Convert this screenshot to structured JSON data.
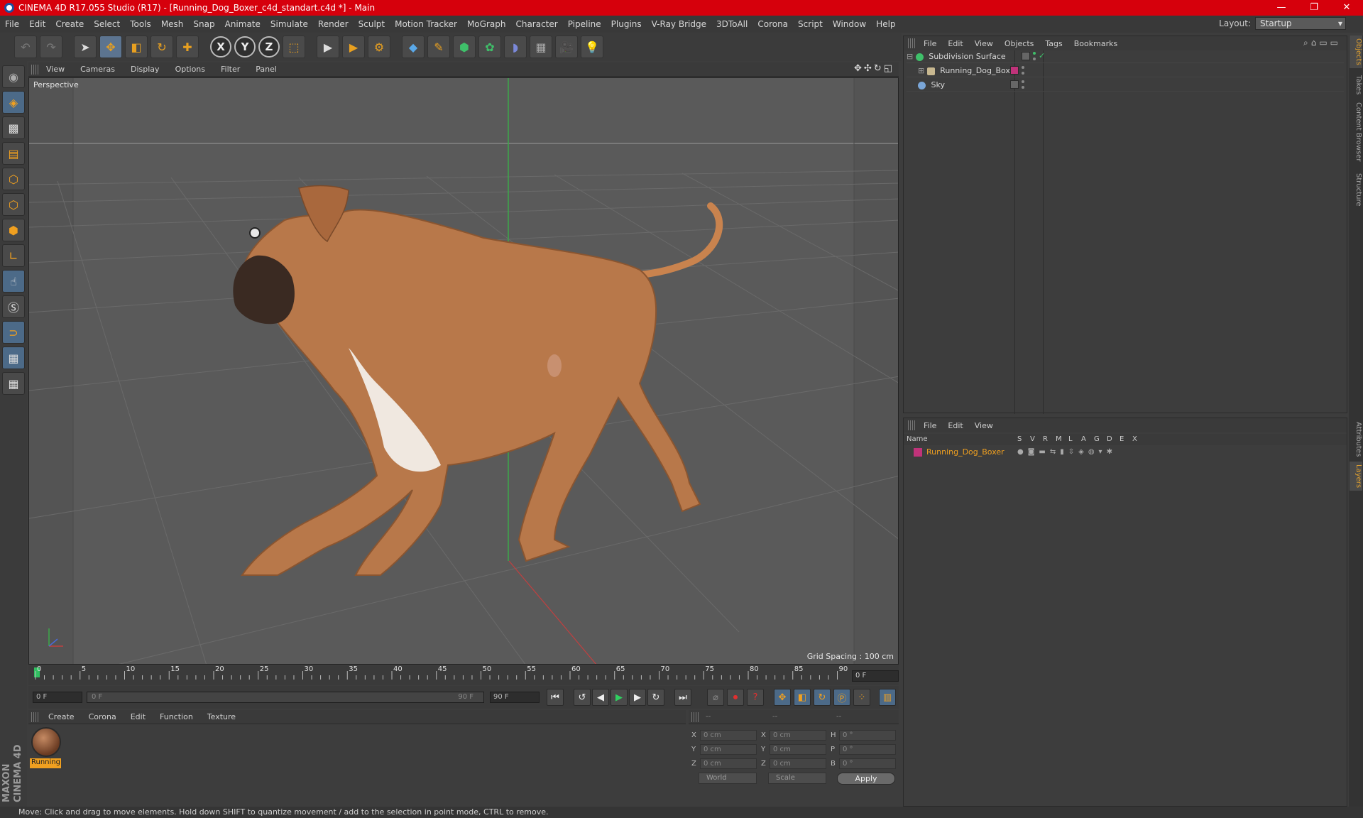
{
  "window": {
    "title": "CINEMA 4D R17.055 Studio (R17) - [Running_Dog_Boxer_c4d_standart.c4d *] - Main",
    "controls": [
      "—",
      "❐",
      "✕"
    ]
  },
  "menubar": {
    "items": [
      "File",
      "Edit",
      "Create",
      "Select",
      "Tools",
      "Mesh",
      "Snap",
      "Animate",
      "Simulate",
      "Render",
      "Sculpt",
      "Motion Tracker",
      "MoGraph",
      "Character",
      "Pipeline",
      "Plugins",
      "V-Ray Bridge",
      "3DToAll",
      "Corona",
      "Script",
      "Window",
      "Help"
    ],
    "layout_label": "Layout:",
    "layout_value": "Startup"
  },
  "viewport": {
    "menu": [
      "View",
      "Cameras",
      "Display",
      "Options",
      "Filter",
      "Panel"
    ],
    "label": "Perspective",
    "grid_spacing": "Grid Spacing : 100 cm",
    "nav_icons": "✥✣↻◱"
  },
  "timeline": {
    "ticks": [
      "0",
      "5",
      "10",
      "15",
      "20",
      "25",
      "30",
      "35",
      "40",
      "45",
      "50",
      "55",
      "60",
      "65",
      "70",
      "75",
      "80",
      "85",
      "90"
    ],
    "current_frame": "0 F",
    "start_frame": "0 F",
    "range_start": "0 F",
    "range_end": "90 F",
    "end_frame": "90 F"
  },
  "material_manager": {
    "menu": [
      "Create",
      "Corona",
      "Edit",
      "Function",
      "Texture"
    ],
    "material_name": "Running"
  },
  "coordinates": {
    "header": [
      "--",
      "--",
      "--"
    ],
    "rows": [
      {
        "a": "X",
        "av": "0 cm",
        "b": "X",
        "bv": "0 cm",
        "c": "H",
        "cv": "0 °"
      },
      {
        "a": "Y",
        "av": "0 cm",
        "b": "Y",
        "bv": "0 cm",
        "c": "P",
        "cv": "0 °"
      },
      {
        "a": "Z",
        "av": "0 cm",
        "b": "Z",
        "bv": "0 cm",
        "c": "B",
        "cv": "0 °"
      }
    ],
    "mode1": "World",
    "mode2": "Scale",
    "apply": "Apply"
  },
  "object_manager": {
    "menu": [
      "File",
      "Edit",
      "View",
      "Objects",
      "Tags",
      "Bookmarks"
    ],
    "objects": [
      {
        "name": "Subdivision Surface",
        "color": "#3fc06a"
      },
      {
        "name": "Running_Dog_Boxer",
        "color": "#c8b890"
      },
      {
        "name": "Sky",
        "color": "#7aa6d8"
      }
    ]
  },
  "layer_manager": {
    "menu": [
      "File",
      "Edit",
      "View"
    ],
    "columns": [
      "Name",
      "S",
      "V",
      "R",
      "M",
      "L",
      "A",
      "G",
      "D",
      "E",
      "X"
    ],
    "layer_name": "Running_Dog_Boxer",
    "layer_color": "#c0337a"
  },
  "right_tabs": [
    "Objects",
    "Takes",
    "Content Browser",
    "Structure",
    "Attributes",
    "Layers"
  ],
  "status": "Move: Click and drag to move elements. Hold down SHIFT to quantize movement / add to the selection in point mode, CTRL to remove.",
  "brand": "MAXON CINEMA 4D",
  "colors": {
    "accent": "#f0a020",
    "title_bar": "#d6000c",
    "selection": "#f0a020"
  }
}
